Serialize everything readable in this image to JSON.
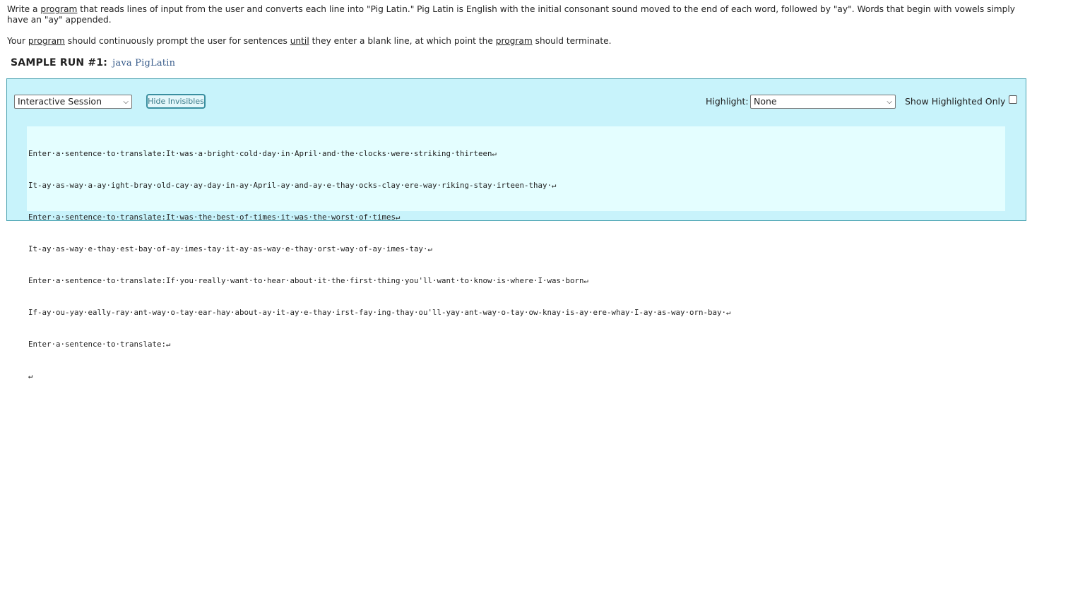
{
  "description": {
    "p1_before": "Write a ",
    "p1_link1": "program",
    "p1_after": " that reads lines of input from the user and converts each line into \"Pig Latin.\" Pig Latin is English with the initial consonant sound moved to the end of each word, followed by \"ay\". Words that begin with vowels simply have an \"ay\" appended.",
    "p2_before": "Your ",
    "p2_link1": "program",
    "p2_mid1": " should continuously prompt the user for sentences ",
    "p2_link2": "until",
    "p2_mid2": " they enter a blank line, at which point the ",
    "p2_link3": "program",
    "p2_after": " should terminate."
  },
  "sample_run": {
    "label": "SAMPLE RUN #1:",
    "command": "java PigLatin"
  },
  "toolbar": {
    "session_select": "Interactive Session",
    "hide_button": "Hide Invisibles",
    "highlight_label": "Highlight:",
    "highlight_select": "None",
    "show_highlighted_label": "Show Highlighted Only"
  },
  "output_lines": [
    "Enter·a·sentence·to·translate:It·was·a·bright·cold·day·in·April·and·the·clocks·were·striking·thirteen↵",
    "It-ay·as-way·a-ay·ight-bray·old-cay·ay-day·in-ay·April-ay·and-ay·e-thay·ocks-clay·ere-way·riking-stay·irteen-thay·↵",
    "Enter·a·sentence·to·translate:It·was·the·best·of·times·it·was·the·worst·of·times↵",
    "It-ay·as-way·e-thay·est-bay·of-ay·imes-tay·it-ay·as-way·e-thay·orst-way·of-ay·imes-tay·↵",
    "Enter·a·sentence·to·translate:If·you·really·want·to·hear·about·it·the·first·thing·you'll·want·to·know·is·where·I·was·born↵",
    "If-ay·ou-yay·eally-ray·ant-way·o-tay·ear-hay·about-ay·it-ay·e-thay·irst-fay·ing-thay·ou'll-yay·ant-way·o-tay·ow-knay·is-ay·ere-whay·I-ay·as-way·orn-bay·↵",
    "Enter·a·sentence·to·translate:↵",
    "↵"
  ]
}
